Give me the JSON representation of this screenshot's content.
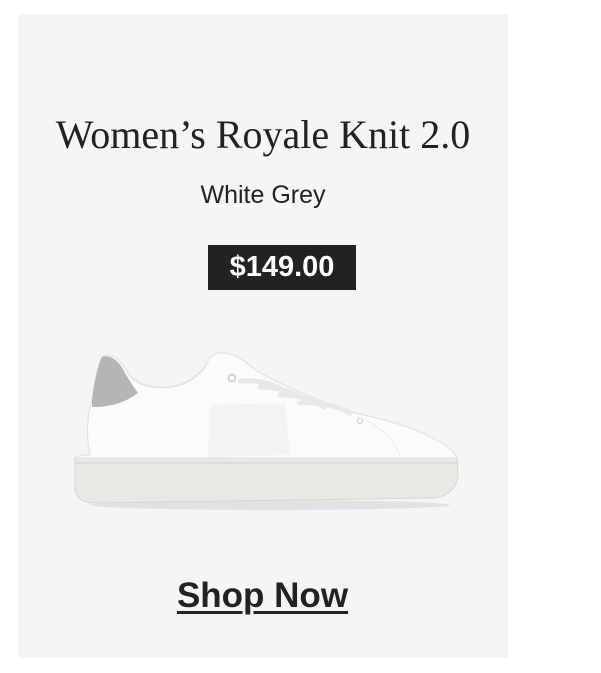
{
  "product": {
    "name": "Women’s Royale Knit 2.0",
    "color": "White Grey",
    "price": "$149.00",
    "image_icon": "sneaker-icon"
  },
  "cta": {
    "label": "Shop Now"
  },
  "colors": {
    "card_background": "#f5f5f5",
    "text": "#222222",
    "price_background": "#222222",
    "price_text": "#ffffff",
    "shoe_heel_accent": "#b5b5b5"
  }
}
